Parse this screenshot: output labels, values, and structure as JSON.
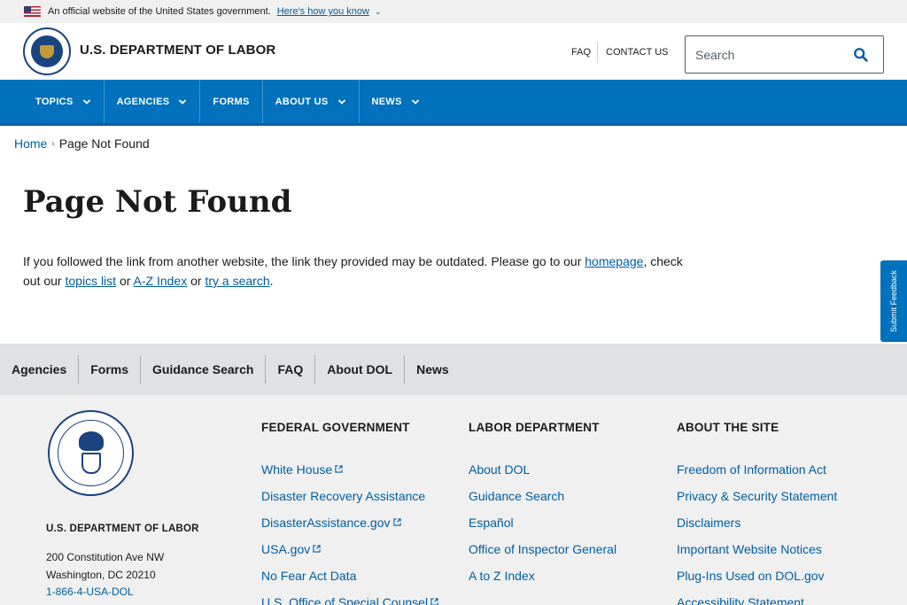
{
  "gov_banner": {
    "text": "An official website of the United States government.",
    "link": "Here's how you know",
    "chevron": "⌄"
  },
  "header": {
    "agency_name": "U.S. DEPARTMENT OF LABOR",
    "utility_links": {
      "faq": "FAQ",
      "contact": "CONTACT US"
    },
    "search_placeholder": "Search"
  },
  "nav": {
    "items": [
      {
        "label": "TOPICS",
        "has_dropdown": true
      },
      {
        "label": "AGENCIES",
        "has_dropdown": true
      },
      {
        "label": "FORMS",
        "has_dropdown": false
      },
      {
        "label": "ABOUT US",
        "has_dropdown": true
      },
      {
        "label": "NEWS",
        "has_dropdown": true
      }
    ]
  },
  "breadcrumb": {
    "home": "Home",
    "separator": "›",
    "current": "Page Not Found"
  },
  "main": {
    "title": "Page Not Found",
    "intro": {
      "t1": "If you followed the link from another website, the link they provided may be outdated. Please go to our ",
      "link1": "homepage",
      "t2": ", check out our ",
      "link2": "topics list",
      "t3": " or ",
      "link3": "A-Z Index",
      "t4": " or ",
      "link4": "try a search",
      "t5": "."
    }
  },
  "feedback_tab": "Submit Feedback",
  "footer_links": [
    "Agencies",
    "Forms",
    "Guidance Search",
    "FAQ",
    "About DOL",
    "News"
  ],
  "footer": {
    "agency": "U.S. DEPARTMENT OF LABOR",
    "address_line1": "200 Constitution Ave NW",
    "address_line2": "Washington, DC 20210",
    "phone": "1-866-4-USA-DOL",
    "columns": [
      {
        "heading": "FEDERAL GOVERNMENT",
        "links": [
          {
            "label": "White House",
            "external": true
          },
          {
            "label": "Disaster Recovery Assistance",
            "external": false
          },
          {
            "label": "DisasterAssistance.gov",
            "external": true
          },
          {
            "label": "USA.gov",
            "external": true
          },
          {
            "label": "No Fear Act Data",
            "external": false
          },
          {
            "label": "U.S. Office of Special Counsel",
            "external": true
          }
        ]
      },
      {
        "heading": "LABOR DEPARTMENT",
        "links": [
          {
            "label": "About DOL",
            "external": false
          },
          {
            "label": "Guidance Search",
            "external": false
          },
          {
            "label": "Español",
            "external": false
          },
          {
            "label": "Office of Inspector General",
            "external": false
          },
          {
            "label": "A to Z Index",
            "external": false
          }
        ]
      },
      {
        "heading": "ABOUT THE SITE",
        "links": [
          {
            "label": "Freedom of Information Act",
            "external": false
          },
          {
            "label": "Privacy & Security Statement",
            "external": false
          },
          {
            "label": "Disclaimers",
            "external": false
          },
          {
            "label": "Important Website Notices",
            "external": false
          },
          {
            "label": "Plug-Ins Used on DOL.gov",
            "external": false
          },
          {
            "label": "Accessibility Statement",
            "external": false
          }
        ]
      }
    ]
  },
  "colors": {
    "primary_blue": "#0071bc",
    "link_blue": "#005ea2",
    "footer_bar": "#dfe1e2",
    "footer_bg": "#f0f0f0"
  }
}
